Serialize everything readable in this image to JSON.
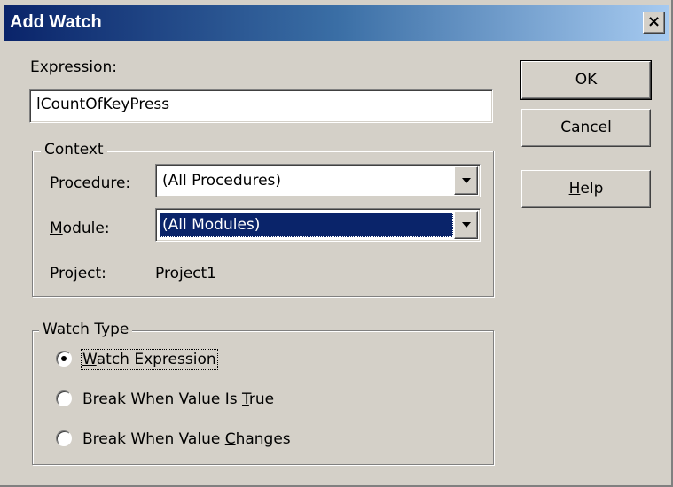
{
  "window": {
    "title": "Add Watch",
    "close_glyph": "×"
  },
  "expression": {
    "label_accel": "E",
    "label_rest": "xpression:",
    "value": "lCountOfKeyPress"
  },
  "context": {
    "legend": "Context",
    "procedure": {
      "label_accel": "P",
      "label_rest": "rocedure:",
      "value": "(All Procedures)"
    },
    "module": {
      "label_accel": "M",
      "label_rest": "odule:",
      "value": "(All Modules)"
    },
    "project": {
      "label": "Project:",
      "value": "Project1"
    }
  },
  "watch_type": {
    "legend": "Watch Type",
    "options": [
      {
        "pre": "",
        "accel": "W",
        "post": "atch Expression",
        "checked": true
      },
      {
        "pre": "Break When Value Is ",
        "accel": "T",
        "post": "rue",
        "checked": false
      },
      {
        "pre": "Break When Value ",
        "accel": "C",
        "post": "hanges",
        "checked": false
      }
    ]
  },
  "buttons": {
    "ok": "OK",
    "cancel": "Cancel",
    "help_accel": "H",
    "help_rest": "elp"
  },
  "colors": {
    "titlebar_start": "#0a246a",
    "titlebar_end": "#a6caf0",
    "face": "#d4d0c8",
    "selection": "#0a246a"
  },
  "icons": {
    "close": "close-icon",
    "dropdown": "chevron-down-icon",
    "radio": "radio-button-icon"
  }
}
